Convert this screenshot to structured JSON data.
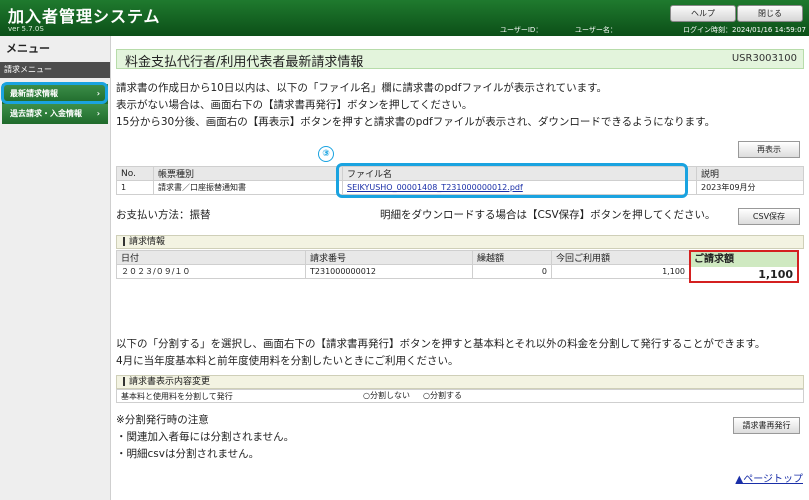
{
  "header": {
    "app_title": "加入者管理システム",
    "version": "ver 5.7.0S",
    "help_label": "ヘルプ",
    "close_label": "閉じる",
    "user_id_label": "ユーザーID：",
    "user_name_label": "ユーザー名：",
    "login_label": "ログイン時刻：2024/01/16 14:59:07"
  },
  "sidebar": {
    "title": "メニュー",
    "group": "請求メニュー",
    "items": [
      {
        "label": "最新請求情報",
        "chevron": "›",
        "selected": true
      },
      {
        "label": "過去請求・入金情報",
        "chevron": "›",
        "selected": false
      }
    ]
  },
  "page": {
    "title": "料金支払代行者/利用代表者最新請求情報",
    "screen_code": "USR3003100",
    "intro": [
      "請求書の作成日から10日以内は、以下の「ファイル名」欄に請求書のpdfファイルが表示されています。",
      "表示がない場合は、画面右下の【請求書再発行】ボタンを押してください。",
      "15分から30分後、画面右の【再表示】ボタンを押すと請求書のpdfファイルが表示され、ダウンロードできるようになります。"
    ],
    "reload_button": "再表示",
    "annotation_number": "③",
    "files_table": {
      "headers": [
        "No.",
        "帳票種別",
        "ファイル名",
        "説明"
      ],
      "rows": [
        {
          "no": "1",
          "type": "請求書／口座振替通知書",
          "file": "SEIKYUSHO_00001408_T231000000012.pdf",
          "desc": "2023年09月分"
        }
      ]
    },
    "payment_method": "お支払い方法：振替",
    "csv_note": "明細をダウンロードする場合は【CSV保存】ボタンを押してください。",
    "csv_button": "CSV保存",
    "billing_section": "請求情報",
    "billing_table": {
      "headers": [
        "日付",
        "請求番号",
        "繰越額",
        "今回ご利用額",
        "ご請求額"
      ],
      "row": {
        "date": "２０２３/０９/１０",
        "number": "T231000000012",
        "carry": "0",
        "usage": "1,100",
        "due": "1,100"
      }
    },
    "split_text": [
      "以下の「分割する」を選択し、画面右下の【請求書再発行】ボタンを押すと基本料とそれ以外の料金を分割して発行することができます。",
      "4月に当年度基本料と前年度使用料を分割したいときにご利用ください。"
    ],
    "display_section": "請求書表示内容変更",
    "split_row_label": "基本料と使用料を分割して発行",
    "radio_no": "分割しない",
    "radio_yes": "分割する",
    "notes_title": "※分割発行時の注意",
    "notes": [
      "・関連加入者毎には分割されません。",
      "・明細csvは分割されません。"
    ],
    "reissue_button": "請求書再発行",
    "page_top": "▲ページトップ"
  }
}
